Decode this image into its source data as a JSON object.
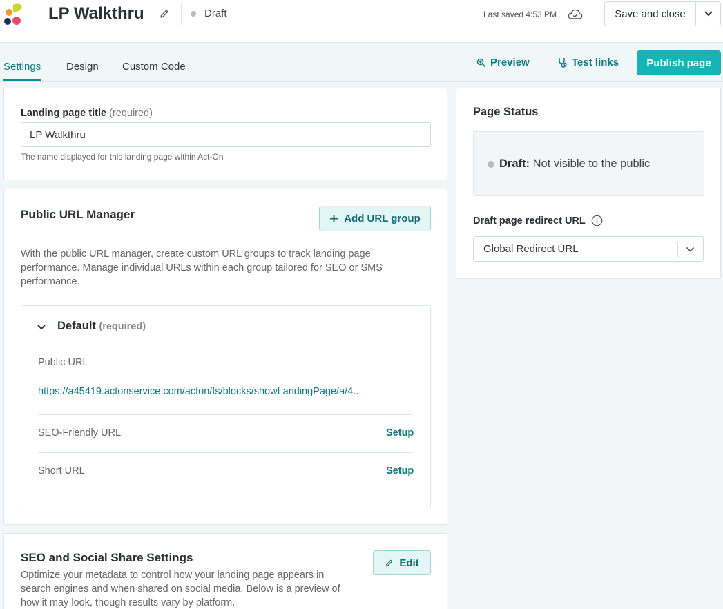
{
  "header": {
    "title": "LP Walkthru",
    "status": "Draft",
    "last_saved": "Last saved 4:53 PM",
    "save_close_label": "Save and close"
  },
  "tabs": [
    {
      "label": "Settings",
      "active": true
    },
    {
      "label": "Design",
      "active": false
    },
    {
      "label": "Custom Code",
      "active": false
    }
  ],
  "toolbar": {
    "preview_label": "Preview",
    "test_links_label": "Test links",
    "publish_label": "Publish page"
  },
  "title_card": {
    "label": "Landing page title",
    "required": "(required)",
    "value": "LP Walkthru",
    "helper": "The name displayed for this landing page within Act-On"
  },
  "url_manager": {
    "heading": "Public URL Manager",
    "add_button": "Add URL group",
    "description": "With the public URL manager, create custom URL groups to track landing page performance. Manage individual URLs within each group tailored for SEO or SMS performance.",
    "group": {
      "name": "Default",
      "required": "(required)",
      "public_url_label": "Public URL",
      "public_url": "https://a45419.actonservice.com/acton/fs/blocks/showLandingPage/a/4...",
      "seo_label": "SEO-Friendly URL",
      "seo_action": "Setup",
      "short_label": "Short URL",
      "short_action": "Setup"
    }
  },
  "seo_card": {
    "heading": "SEO and Social Share Settings",
    "edit_label": "Edit",
    "description": "Optimize your metadata to control how your landing page appears in search engines and when shared on social media. Below is a preview of how it may look, though results vary by platform."
  },
  "page_status": {
    "heading": "Page Status",
    "status_bold": "Draft:",
    "status_text": "Not visible to the public",
    "redirect_label": "Draft page redirect URL",
    "redirect_value": "Global Redirect URL"
  },
  "colors": {
    "accent": "#16b3b9",
    "link": "#0b7a82"
  }
}
